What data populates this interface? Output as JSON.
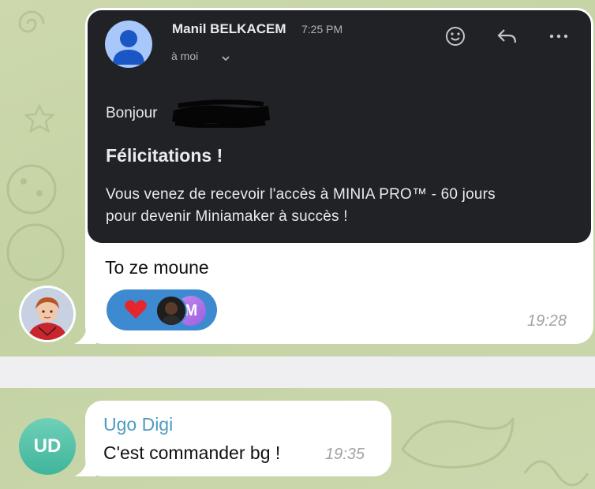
{
  "email": {
    "sender_name": "Manil BELKACEM",
    "time": "7:25 PM",
    "recipient": "à moi",
    "greeting": "Bonjour",
    "congrats": "Félicitations !",
    "body_line_1": "Vous venez de recevoir l'accès à MINIA PRO™ - 60 jours",
    "body_line_2": "pour devenir Miniamaker à succès !",
    "icons": [
      "emoji-icon",
      "reply-icon",
      "more-icon",
      "chevron-down-icon"
    ]
  },
  "message1": {
    "caption": "To ze moune",
    "time": "19:28",
    "reactions": {
      "emoji": "heart",
      "reactor_initial": "M"
    }
  },
  "message2": {
    "sender": "Ugo Digi",
    "text": "C'est commander bg !",
    "time": "19:35",
    "avatar_initials": "UD"
  },
  "colors": {
    "chat_background": "#c8d6a8",
    "email_card": "#212226",
    "reaction_pill": "#3d8ad0",
    "sender_name_2": "#4e9bc2",
    "avatar_ud": "#4fc2a6"
  }
}
